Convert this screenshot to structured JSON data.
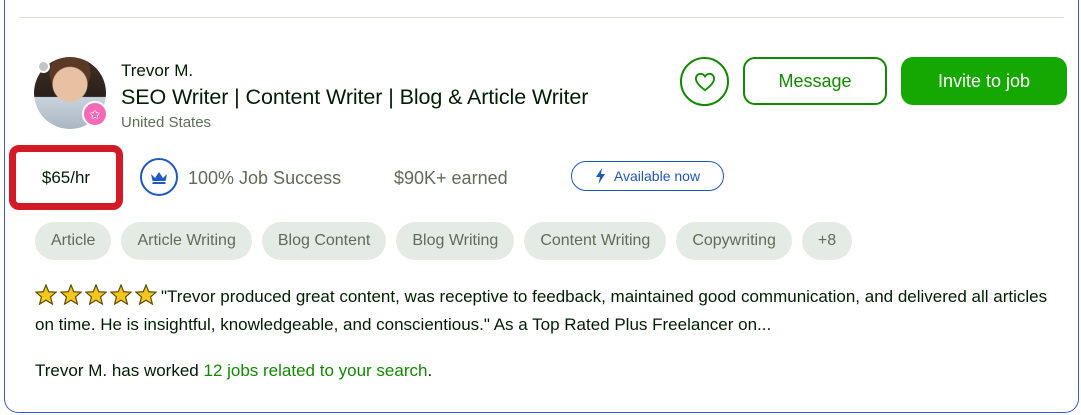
{
  "freelancer": {
    "name": "Trevor M.",
    "title": "SEO Writer | Content Writer | Blog & Article Writer",
    "location": "United States"
  },
  "actions": {
    "save_icon": "heart-icon",
    "message_label": "Message",
    "invite_label": "Invite to job"
  },
  "stats": {
    "rate": "$65/hr",
    "job_success": "100% Job Success",
    "earned": "$90K+ earned",
    "availability": "Available now"
  },
  "skills": [
    "Article",
    "Article Writing",
    "Blog Content",
    "Blog Writing",
    "Content Writing",
    "Copywriting",
    "+8"
  ],
  "review": {
    "stars": 5,
    "text": "\"Trevor produced great content, was receptive to feedback, maintained good communication, and delivered all articles on time. He is insightful, knowledgeable, and conscientious.\" As a Top Rated Plus Freelancer on..."
  },
  "jobs": {
    "prefix": "Trevor M. has worked ",
    "link": "12 jobs related to your search",
    "suffix": "."
  },
  "colors": {
    "primary_green": "#14a800",
    "link_green": "#108a00",
    "accent_blue": "#1f57c3",
    "highlight_red": "#d31b28",
    "star_gold": "#f5c71a"
  }
}
